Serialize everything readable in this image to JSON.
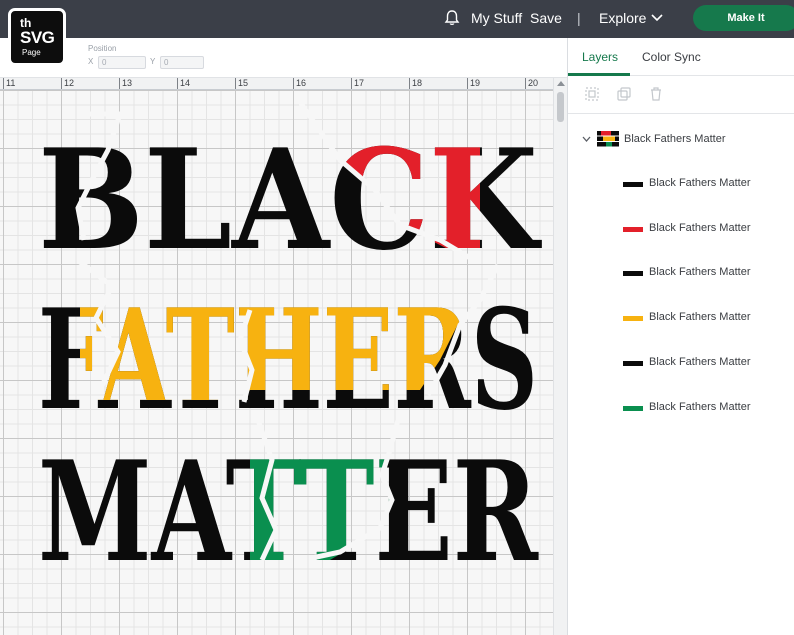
{
  "brand": {
    "line1": "th",
    "line2": "SVG",
    "line3": "Page"
  },
  "topbar": {
    "my_stuff": "My Stuff",
    "save": "Save",
    "separator": "|",
    "explore": "Explore",
    "make_it": "Make It"
  },
  "position_toolbar": {
    "label": "Position",
    "x_axis": "X",
    "y_axis": "Y",
    "x_value": "0",
    "y_value": "0"
  },
  "ruler": {
    "ticks": [
      "11",
      "12",
      "13",
      "14",
      "15",
      "16",
      "17",
      "18",
      "19",
      "20"
    ]
  },
  "design": {
    "lines": [
      "BLACK",
      "FATHERS",
      "MATTER"
    ],
    "colors": {
      "red": "#e3202a",
      "yellow": "#f7b210",
      "green": "#0a8f4f",
      "black": "#0b0b0b"
    }
  },
  "panel": {
    "tabs": [
      {
        "label": "Layers",
        "active": true
      },
      {
        "label": "Color Sync",
        "active": false
      }
    ],
    "group": {
      "label": "Black Fathers Matter",
      "expanded": true
    },
    "layers": [
      {
        "label": "Black Fathers Matter",
        "thumb_color": "#0b0b0b"
      },
      {
        "label": "Black Fathers Matter",
        "thumb_color": "#e3202a"
      },
      {
        "label": "Black Fathers Matter",
        "thumb_color": "#0b0b0b"
      },
      {
        "label": "Black Fathers Matter",
        "thumb_color": "#f7b210"
      },
      {
        "label": "Black Fathers Matter",
        "thumb_color": "#0b0b0b"
      },
      {
        "label": "Black Fathers Matter",
        "thumb_color": "#0a8f4f"
      }
    ]
  },
  "colors": {
    "topbar": "#3b3f48",
    "accent": "#16794c"
  }
}
